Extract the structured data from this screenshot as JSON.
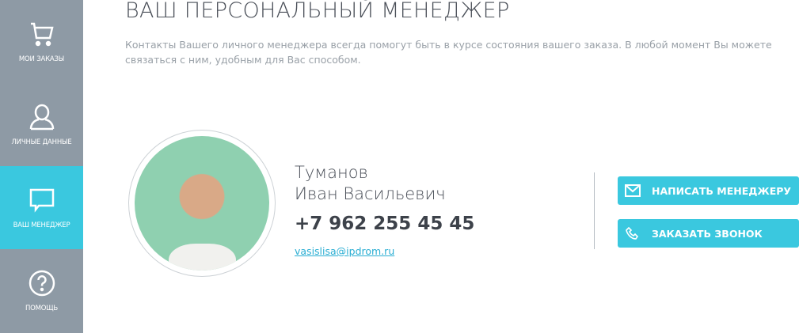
{
  "sidebar": {
    "items": [
      {
        "label": "МОИ ЗАКАЗЫ",
        "icon": "cart-icon"
      },
      {
        "label": "ЛИЧНЫЕ ДАННЫЕ",
        "icon": "user-icon"
      },
      {
        "label": "ВАШ МЕНЕДЖЕР",
        "icon": "chat-icon",
        "active": true
      },
      {
        "label": "ПОМОЩЬ",
        "icon": "help-icon"
      }
    ]
  },
  "main": {
    "title": "ВАШ ПЕРСОНАЛЬНЫЙ МЕНЕДЖЕР",
    "description": "Контакты Вашего личного менеджера всегда помогут быть в курсе состояния вашего заказа. В любой момент Вы можете связаться с ним, удобным для Вас способом.",
    "manager": {
      "surname": "Туманов",
      "name": "Иван Васильевич",
      "phone": "+7 962 255 45 45",
      "email": "vasislisa@ipdrom.ru"
    },
    "buttons": {
      "write": "НАПИСАТЬ МЕНЕДЖЕРУ",
      "call": "ЗАКАЗАТЬ ЗВОНОК"
    }
  },
  "colors": {
    "accent": "#3ac8df",
    "sidebar": "#8e9aa5"
  }
}
